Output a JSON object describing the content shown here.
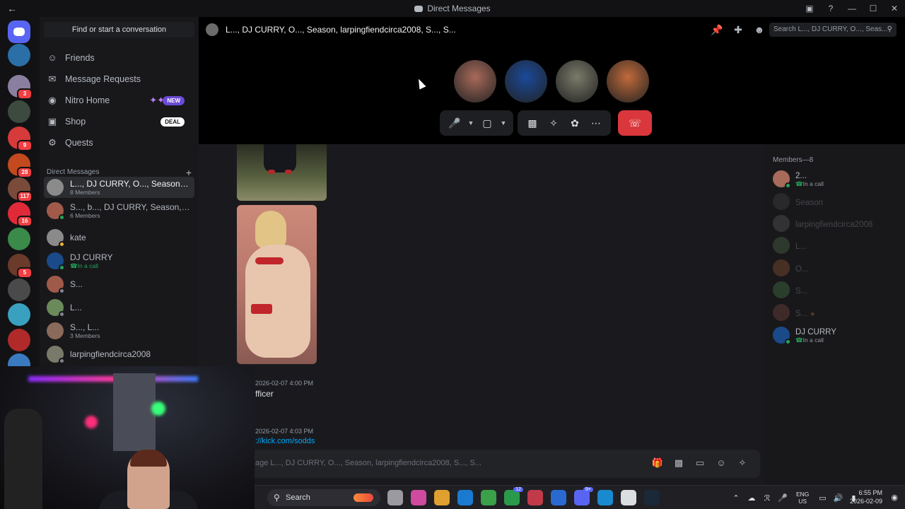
{
  "window": {
    "title": "Direct Messages",
    "back": "←",
    "controls": [
      "▣",
      "?",
      "—",
      "☐",
      "✕"
    ]
  },
  "servers": [
    {
      "id": "home",
      "badge": "",
      "color": "#5865f2"
    },
    {
      "id": "s1",
      "badge": "",
      "color": "#2a6fa8"
    },
    {
      "id": "s2",
      "badge": "3",
      "color": "#8a7fa0"
    },
    {
      "id": "s3",
      "badge": "",
      "color": "#3d4a3f"
    },
    {
      "id": "s4",
      "badge": "9",
      "color": "#d63a3a"
    },
    {
      "id": "s5",
      "badge": "28",
      "color": "#c24a1e"
    },
    {
      "id": "s6",
      "badge": "117",
      "color": "#7a4a3a"
    },
    {
      "id": "s7",
      "badge": "16",
      "color": "#e02a3a"
    },
    {
      "id": "s8",
      "badge": "",
      "color": "#3a8a4a"
    },
    {
      "id": "s9",
      "badge": "5",
      "color": "#6a3a2a"
    },
    {
      "id": "s10",
      "badge": "",
      "color": "#4a4a4a"
    },
    {
      "id": "s11",
      "badge": "",
      "color": "#3aa0c0"
    },
    {
      "id": "s12",
      "badge": "",
      "color": "#b02a2a"
    },
    {
      "id": "s13",
      "badge": "",
      "color": "#3a7ac0"
    }
  ],
  "sidebar": {
    "find_placeholder": "Find or start a conversation",
    "nav": [
      {
        "label": "Friends",
        "icon": "friends-icon"
      },
      {
        "label": "Message Requests",
        "icon": "mail-icon"
      },
      {
        "label": "Nitro Home",
        "icon": "nitro-icon",
        "tag": "NEW"
      },
      {
        "label": "Shop",
        "icon": "shop-icon",
        "tag": "DEAL"
      },
      {
        "label": "Quests",
        "icon": "quests-icon"
      }
    ],
    "dm_header": "Direct Messages",
    "dms": [
      {
        "name": "L..., DJ CURRY, O..., Season, lar...",
        "sub": "8 Members",
        "call": false,
        "active": true,
        "avatar": "#8a8a8a",
        "status": ""
      },
      {
        "name": "S..., b..., DJ CURRY, Season, larp...",
        "sub": "6 Members",
        "call": false,
        "active": false,
        "avatar": "#a05a4a",
        "status": "#23a55a"
      },
      {
        "name": "kate",
        "sub": "",
        "call": false,
        "active": false,
        "avatar": "#8a8a8a",
        "status": "#f0b232"
      },
      {
        "name": "DJ CURRY",
        "sub": "In a call",
        "call": true,
        "active": false,
        "avatar": "#1a4a8a",
        "status": "#23a55a"
      },
      {
        "name": "S...",
        "sub": "",
        "call": false,
        "active": false,
        "avatar": "#a05a4a",
        "status": "#80848e"
      },
      {
        "name": "L...",
        "sub": "",
        "call": false,
        "active": false,
        "avatar": "#6a8a5a",
        "status": "#80848e"
      },
      {
        "name": "S..., L...",
        "sub": "3 Members",
        "call": false,
        "active": false,
        "avatar": "#8a6a5a",
        "status": ""
      },
      {
        "name": "larpingfiendcirca2008",
        "sub": "",
        "call": false,
        "active": false,
        "avatar": "#7a7a6a",
        "status": "#80848e"
      }
    ]
  },
  "channel": {
    "title": "L..., DJ CURRY, O..., Season, larpingfiendcirca2008, S..., S...",
    "search_placeholder": "Search L..., DJ CURRY, O..., Seas..."
  },
  "call": {
    "participants": [
      {
        "color": "#a86a5a"
      },
      {
        "color": "#1a4a9a"
      },
      {
        "color": "#7a7a6a"
      },
      {
        "color": "#c06a3a"
      }
    ]
  },
  "messages": [
    {
      "time": "2026-02-07 4:00 PM",
      "text": "fficer"
    },
    {
      "time": "2026-02-07 4:03 PM",
      "link": "://kick.com/sodds"
    }
  ],
  "composer": {
    "placeholder": "age L..., DJ CURRY, O..., Season, larpingfiendcirca2008, S..., S..."
  },
  "members": {
    "header": "Members—8",
    "list": [
      {
        "name": "2...",
        "sub": "In a call",
        "call": true,
        "off": false,
        "avatar": "#a86a5a",
        "status": true,
        "star": false
      },
      {
        "name": "Season",
        "sub": "",
        "call": false,
        "off": true,
        "avatar": "#555",
        "status": false,
        "star": false
      },
      {
        "name": "larpingfiendcirca2008",
        "sub": "",
        "call": false,
        "off": true,
        "avatar": "#777",
        "status": false,
        "star": false
      },
      {
        "name": "L...",
        "sub": "",
        "call": false,
        "off": true,
        "avatar": "#6a8a5a",
        "status": false,
        "star": false
      },
      {
        "name": "O...",
        "sub": "",
        "call": false,
        "off": true,
        "avatar": "#c06a3a",
        "status": false,
        "star": false
      },
      {
        "name": "S...",
        "sub": "",
        "call": false,
        "off": true,
        "avatar": "#5aa05a",
        "status": false,
        "star": false
      },
      {
        "name": "S...",
        "sub": "",
        "call": false,
        "off": true,
        "avatar": "#a05a4a",
        "status": false,
        "star": true
      },
      {
        "name": "DJ CURRY",
        "sub": "In a call",
        "call": true,
        "off": false,
        "avatar": "#1a4a8a",
        "status": true,
        "star": false
      }
    ]
  },
  "taskbar": {
    "search_label": "Search",
    "apps": [
      {
        "color": "#9a9aa0",
        "badge": ""
      },
      {
        "color": "#d04aa0",
        "badge": ""
      },
      {
        "color": "#e0a030",
        "badge": ""
      },
      {
        "color": "#1a7ad0",
        "badge": ""
      },
      {
        "color": "#3aa04a",
        "badge": ""
      },
      {
        "color": "#2a9a4a",
        "badge": "12"
      },
      {
        "color": "#c03a4a",
        "badge": ""
      },
      {
        "color": "#2a6ad0",
        "badge": ""
      },
      {
        "color": "#5865f2",
        "badge": "9+"
      },
      {
        "color": "#1a8ad0",
        "badge": ""
      },
      {
        "color": "#dbdee1",
        "badge": ""
      },
      {
        "color": "#1b2838",
        "badge": ""
      }
    ],
    "lang_top": "ENG",
    "lang_bottom": "US",
    "time": "6:55 PM",
    "date": "2026-02-09"
  }
}
